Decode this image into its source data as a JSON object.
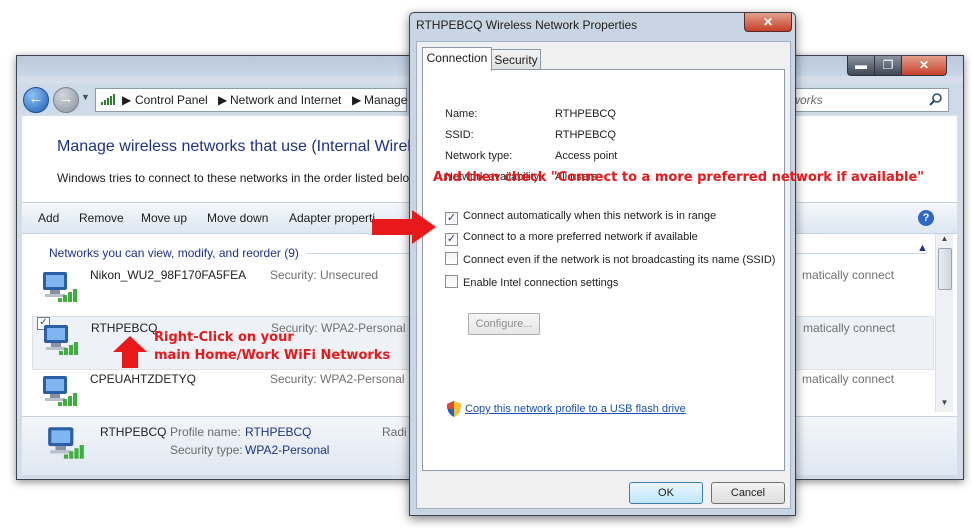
{
  "colors": {
    "link": "#1a4fb5",
    "heading": "#1e3287",
    "annotation": "#e8181b",
    "window_chrome": "#c9d5e3"
  },
  "background_window": {
    "caption_buttons": {
      "minimize": "▬",
      "maximize": "❐",
      "close": "✕"
    },
    "breadcrumb": [
      "Control Panel",
      "Network and Internet",
      "Manage"
    ],
    "breadcrumb_separator": "▶",
    "search_text": "tworks",
    "heading": "Manage wireless networks that use (Internal Wirele",
    "description": "Windows tries to connect to these networks in the order listed belo",
    "toolbar": [
      "Add",
      "Remove",
      "Move up",
      "Move down",
      "Adapter properti"
    ],
    "help_label": "?",
    "group_header": "Networks you can view, modify, and reorder (9)",
    "networks": [
      {
        "name": "Nikon_WU2_98F170FA5FEA",
        "security": "Security:  Unsecured",
        "mode": "matically connect"
      },
      {
        "name": "RTHPEBCQ",
        "security": "Security:  WPA2-Personal",
        "mode": "matically connect"
      },
      {
        "name": "CPEUAHTZDETYQ",
        "security": "Security:  WPA2-Personal",
        "mode": "matically connect"
      }
    ],
    "details": {
      "name": "RTHPEBCQ",
      "profile_label": "Profile name:",
      "profile_value": "RTHPEBCQ",
      "security_label": "Security type:",
      "security_value": "WPA2-Personal",
      "radio": "Radi"
    }
  },
  "dialog": {
    "title": "RTHPEBCQ Wireless Network Properties",
    "close_label": "✕",
    "tabs": [
      "Connection",
      "Security"
    ],
    "fields": [
      {
        "label": "Name:",
        "value": "RTHPEBCQ"
      },
      {
        "label": "SSID:",
        "value": "RTHPEBCQ"
      },
      {
        "label": "Network type:",
        "value": "Access point"
      },
      {
        "label": "Network availability:",
        "value": "All users"
      }
    ],
    "checkboxes": [
      {
        "label": "Connect automatically when this network is in range",
        "checked": true
      },
      {
        "label": "Connect to a more preferred network if available",
        "checked": true
      },
      {
        "label": "Connect even if the network is not broadcasting its name (SSID)",
        "checked": false
      },
      {
        "label": "Enable Intel connection settings",
        "checked": false
      }
    ],
    "configure_button": "Configure...",
    "usb_link": "Copy this network profile to a USB flash drive",
    "ok_button": "OK",
    "cancel_button": "Cancel"
  },
  "annotations": {
    "top": "And then check \"Connect to a more preferred network if available\"",
    "left_line1": "Right-Click on your",
    "left_line2": "main Home/Work WiFi Networks"
  }
}
